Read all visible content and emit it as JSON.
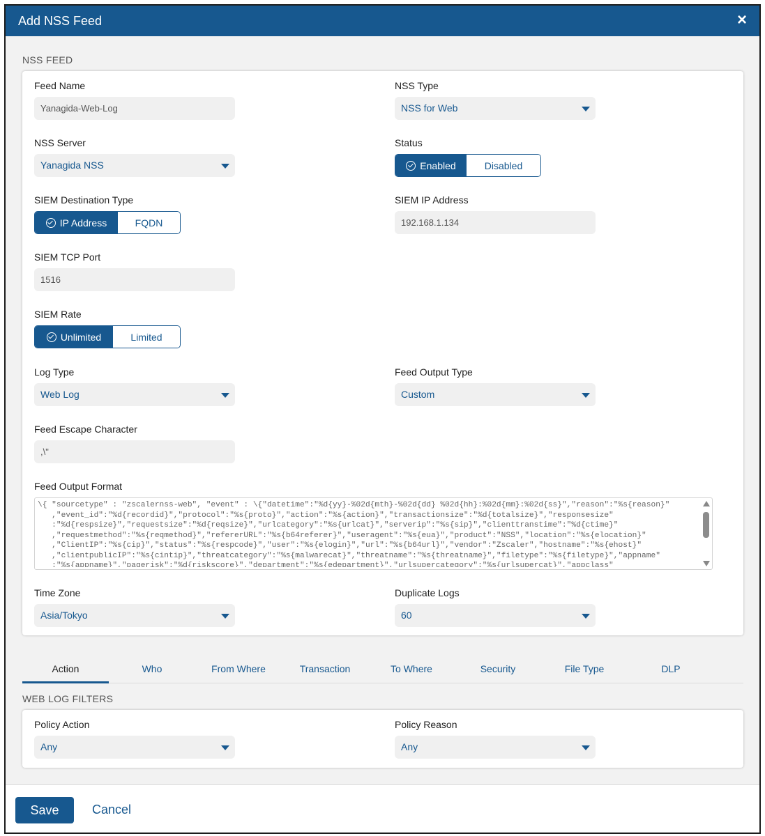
{
  "header": {
    "title": "Add NSS Feed",
    "close_icon": "×"
  },
  "nss_feed": {
    "section_title": "NSS FEED",
    "feed_name": {
      "label": "Feed Name",
      "value": "Yanagida-Web-Log"
    },
    "nss_type": {
      "label": "NSS Type",
      "value": "NSS for Web"
    },
    "nss_server": {
      "label": "NSS Server",
      "value": "Yanagida NSS"
    },
    "status": {
      "label": "Status",
      "options": [
        "Enabled",
        "Disabled"
      ],
      "selected": "Enabled"
    },
    "siem_destination_type": {
      "label": "SIEM Destination Type",
      "options": [
        "IP Address",
        "FQDN"
      ],
      "selected": "IP Address"
    },
    "siem_ip_address": {
      "label": "SIEM IP Address",
      "value": "192.168.1.134"
    },
    "siem_tcp_port": {
      "label": "SIEM TCP Port",
      "value": "1516"
    },
    "siem_rate": {
      "label": "SIEM Rate",
      "options": [
        "Unlimited",
        "Limited"
      ],
      "selected": "Unlimited"
    },
    "log_type": {
      "label": "Log Type",
      "value": "Web Log"
    },
    "feed_output_type": {
      "label": "Feed Output Type",
      "value": "Custom"
    },
    "feed_escape_character": {
      "label": "Feed Escape Character",
      "value": ",\\\""
    },
    "feed_output_format": {
      "label": "Feed Output Format",
      "value": "\\{ \"sourcetype\" : \"zscalernss-web\", \"event\" : \\{\"datetime\":\"%d{yy}-%02d{mth}-%02d{dd} %02d{hh}:%02d{mm}:%02d{ss}\",\"reason\":\"%s{reason}\"\n   ,\"event_id\":\"%d{recordid}\",\"protocol\":\"%s{proto}\",\"action\":\"%s{action}\",\"transactionsize\":\"%d{totalsize}\",\"responsesize\"\n   :\"%d{respsize}\",\"requestsize\":\"%d{reqsize}\",\"urlcategory\":\"%s{urlcat}\",\"serverip\":\"%s{sip}\",\"clienttranstime\":\"%d{ctime}\"\n   ,\"requestmethod\":\"%s{reqmethod}\",\"refererURL\":\"%s{b64referer}\",\"useragent\":\"%s{eua}\",\"product\":\"NSS\",\"location\":\"%s{elocation}\"\n   ,\"ClientIP\":\"%s{cip}\",\"status\":\"%s{respcode}\",\"user\":\"%s{elogin}\",\"url\":\"%s{b64url}\",\"vendor\":\"Zscaler\",\"hostname\":\"%s{ehost}\"\n   ,\"clientpublicIP\":\"%s{cintip}\",\"threatcategory\":\"%s{malwarecat}\",\"threatname\":\"%s{threatname}\",\"filetype\":\"%s{filetype}\",\"appname\"\n   :\"%s{appname}\",\"pagerisk\":\"%d{riskscore}\",\"department\":\"%s{edepartment}\",\"urlsupercategory\":\"%s{urlsupercat}\",\"appclass\""
    },
    "time_zone": {
      "label": "Time Zone",
      "value": "Asia/Tokyo"
    },
    "duplicate_logs": {
      "label": "Duplicate Logs",
      "value": "60"
    }
  },
  "tabs": [
    "Action",
    "Who",
    "From Where",
    "Transaction",
    "To Where",
    "Security",
    "File Type",
    "DLP"
  ],
  "active_tab": "Action",
  "web_log_filters": {
    "section_title": "WEB LOG FILTERS",
    "policy_action": {
      "label": "Policy Action",
      "value": "Any"
    },
    "policy_reason": {
      "label": "Policy Reason",
      "value": "Any"
    }
  },
  "footer": {
    "save_label": "Save",
    "cancel_label": "Cancel"
  },
  "colors": {
    "primary": "#17588f",
    "background": "#f2f2f2",
    "input_bg": "#f0f0f0"
  }
}
